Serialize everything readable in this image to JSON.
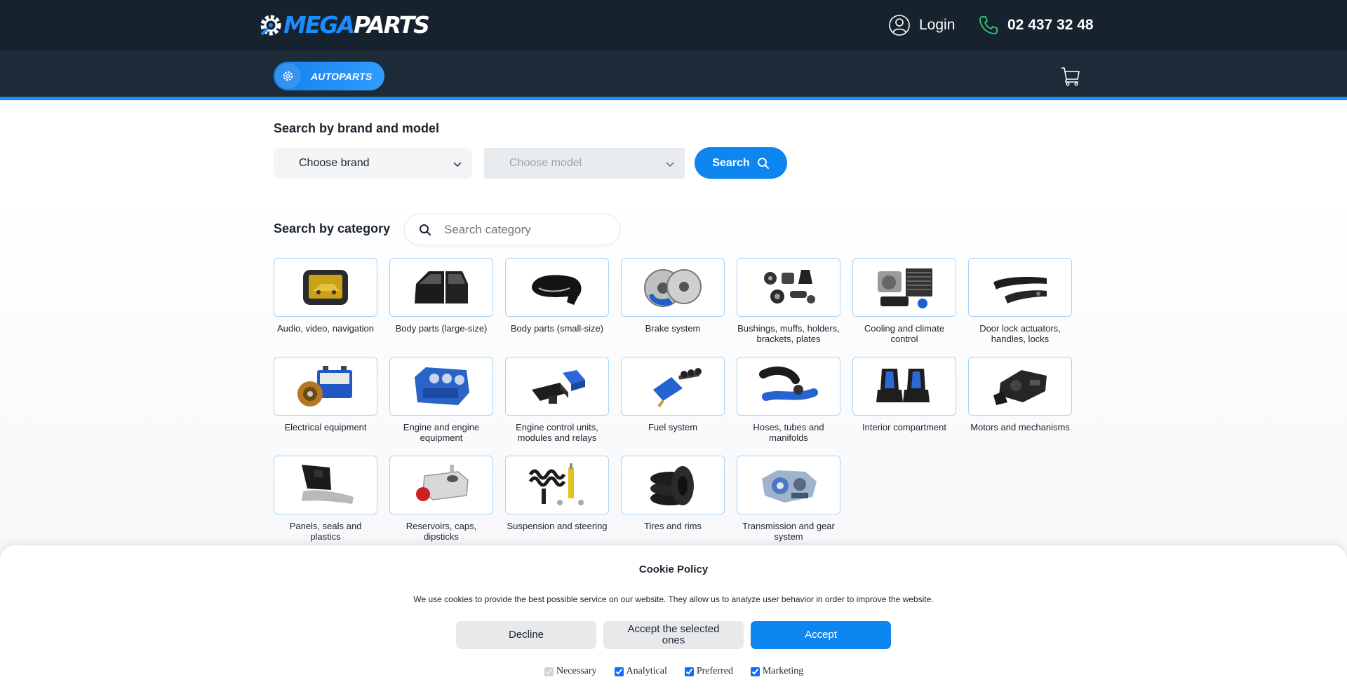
{
  "header": {
    "logo_mega": "MEGA",
    "logo_parts": "PARTS",
    "login_label": "Login",
    "phone": "02 437 32 48",
    "autoparts_label": "AUTOPARTS"
  },
  "brand_search": {
    "title": "Search by brand and model",
    "brand_selected": "Choose brand",
    "model_selected": "Choose model",
    "search_label": "Search"
  },
  "category_search": {
    "title": "Search by category",
    "placeholder": "Search category"
  },
  "categories": [
    {
      "label": "Audio, video, navigation",
      "icon": "car-monitor-icon"
    },
    {
      "label": "Body parts (large-size)",
      "icon": "car-door-icon"
    },
    {
      "label": "Body parts (small-size)",
      "icon": "side-mirror-icon"
    },
    {
      "label": "Brake system",
      "icon": "brake-disc-icon"
    },
    {
      "label": "Bushings, muffs, holders, brackets, plates",
      "icon": "bushings-icon"
    },
    {
      "label": "Cooling and climate control",
      "icon": "compressor-icon"
    },
    {
      "label": "Door lock actuators, handles, locks",
      "icon": "door-handle-icon"
    },
    {
      "label": "Electrical equipment",
      "icon": "battery-icon"
    },
    {
      "label": "Engine and engine equipment",
      "icon": "engine-block-icon"
    },
    {
      "label": "Engine control units, modules and relays",
      "icon": "ecu-icon"
    },
    {
      "label": "Fuel system",
      "icon": "fuel-pump-icon"
    },
    {
      "label": "Hoses, tubes and manifolds",
      "icon": "hose-icon"
    },
    {
      "label": "Interior compartment",
      "icon": "car-seat-icon"
    },
    {
      "label": "Motors and mechanisms",
      "icon": "motor-icon"
    },
    {
      "label": "Panels, seals and plastics",
      "icon": "panel-icon"
    },
    {
      "label": "Reservoirs, caps, dipsticks",
      "icon": "reservoir-icon"
    },
    {
      "label": "Suspension and steering",
      "icon": "shock-absorber-icon"
    },
    {
      "label": "Tires and rims",
      "icon": "tires-icon"
    },
    {
      "label": "Transmission and gear system",
      "icon": "gearbox-icon"
    }
  ],
  "cookie": {
    "title": "Cookie Policy",
    "text": "We use cookies to provide the best possible service on our website. They allow us to analyze user behavior in order to improve the website.",
    "decline_label": "Decline",
    "accept_selected_label": "Accept the selected ones",
    "accept_label": "Accept",
    "options": [
      {
        "label": "Necessary",
        "checked": true,
        "disabled": true
      },
      {
        "label": "Analytical",
        "checked": true,
        "disabled": false
      },
      {
        "label": "Preferred",
        "checked": true,
        "disabled": false
      },
      {
        "label": "Marketing",
        "checked": true,
        "disabled": false
      }
    ]
  },
  "colors": {
    "header_bg": "#16222d",
    "subbar_bg": "#1c2b37",
    "accent": "#0d86f0",
    "phone_icon": "#2ecc71"
  }
}
